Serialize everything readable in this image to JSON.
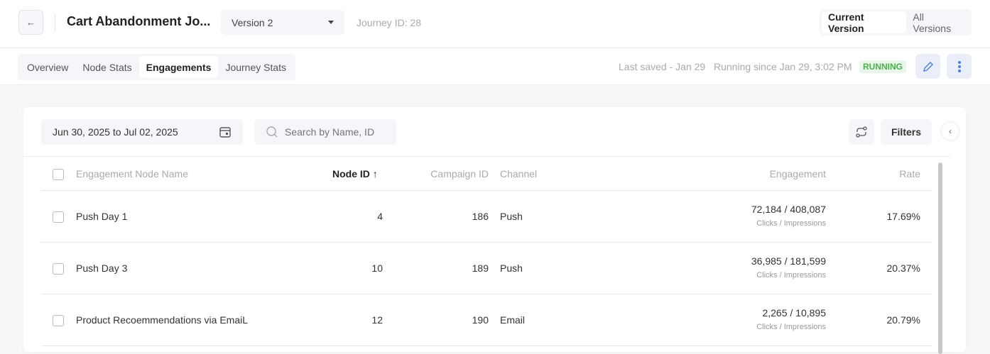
{
  "header": {
    "back_icon": "arrow-left-icon",
    "title": "Cart Abandonment Jo...",
    "version": "Version 2",
    "journey_id": "Journey ID: 28",
    "toggle": [
      "Current Version",
      "All Versions"
    ]
  },
  "tabs": [
    "Overview",
    "Node Stats",
    "Engagements",
    "Journey Stats"
  ],
  "status": {
    "last_saved": "Last saved - Jan 29",
    "running_since": "Running since Jan 29, 3:02 PM",
    "badge": "RUNNING",
    "badge_color": "#4cae4c"
  },
  "toolbar": {
    "date_range": "Jun 30, 2025 to Jul 02, 2025",
    "search_placeholder": "Search by Name, ID",
    "filters": "Filters"
  },
  "table": {
    "columns": [
      "Engagement Node Name",
      "Node ID",
      "Campaign ID",
      "Channel",
      "Engagement",
      "Rate"
    ],
    "sort_indicator": "↑",
    "rows": [
      {
        "name": "Push Day 1",
        "node_id": "4",
        "campaign_id": "186",
        "channel": "Push",
        "engagement": "72,184 / 408,087",
        "engagement_sub": "Clicks / Impressions",
        "rate": "17.69%"
      },
      {
        "name": "Push Day 3",
        "node_id": "10",
        "campaign_id": "189",
        "channel": "Push",
        "engagement": "36,985 / 181,599",
        "engagement_sub": "Clicks / Impressions",
        "rate": "20.37%"
      },
      {
        "name": "Product Recoemmendations via EmaiL",
        "node_id": "12",
        "campaign_id": "190",
        "channel": "Email",
        "engagement": "2,265 / 10,895",
        "engagement_sub": "Clicks / Impressions",
        "rate": "20.79%"
      }
    ]
  }
}
